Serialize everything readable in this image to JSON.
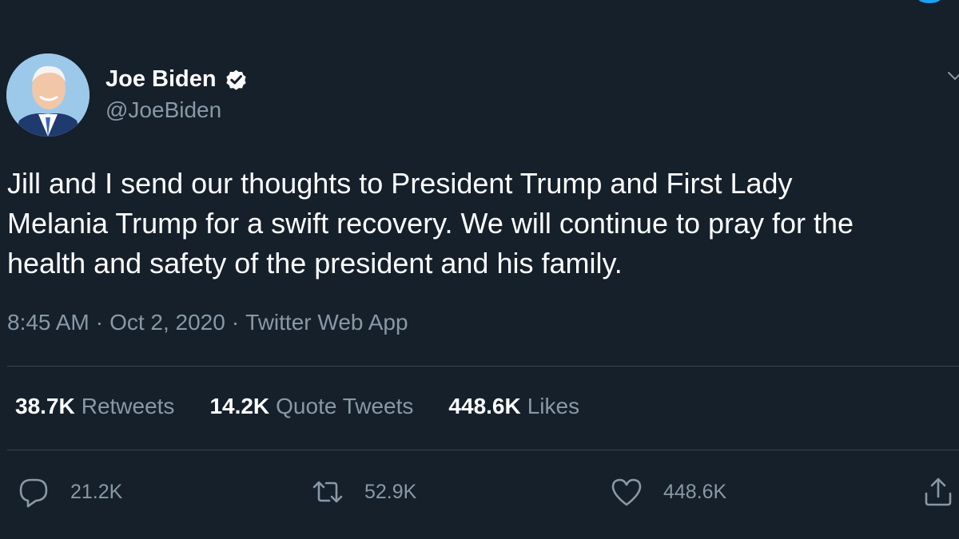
{
  "tweet": {
    "author": {
      "display_name": "Joe Biden",
      "handle": "@JoeBiden",
      "verified": true
    },
    "text": "Jill and I send our thoughts to President Trump and First Lady\nMelania Trump for a swift recovery. We will continue to pray for the\nhealth and safety of the president and his family.",
    "time": "8:45 AM",
    "date": "Oct 2, 2020",
    "source": "Twitter Web App",
    "separator": "·"
  },
  "stats": [
    {
      "value": "38.7K",
      "label": "Retweets"
    },
    {
      "value": "14.2K",
      "label": "Quote Tweets"
    },
    {
      "value": "448.6K",
      "label": "Likes"
    }
  ],
  "actions": {
    "reply": {
      "icon": "reply-icon",
      "count": "21.2K"
    },
    "retweet": {
      "icon": "retweet-icon",
      "count": "52.9K"
    },
    "like": {
      "icon": "heart-icon",
      "count": "448.6K"
    },
    "share": {
      "icon": "share-icon"
    }
  },
  "colors": {
    "background": "#15202b",
    "text_primary": "#ffffff",
    "text_secondary": "#8899a6",
    "divider": "#38444d",
    "accent": "#1da1f2"
  }
}
